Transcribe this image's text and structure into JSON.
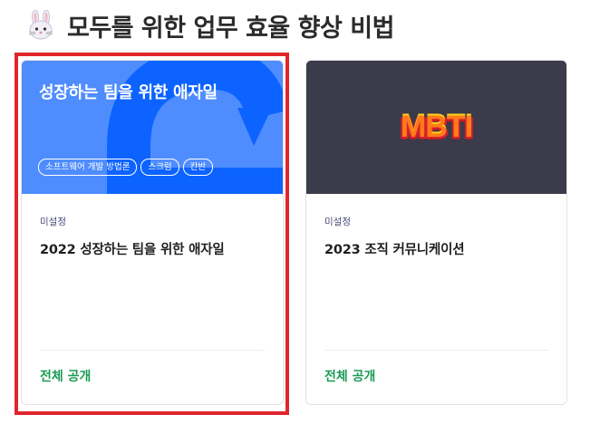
{
  "page": {
    "title": "모두를 위한 업무 효율 향상 비법",
    "title_icon": "bunny-icon"
  },
  "cards": [
    {
      "thumbnail": {
        "title": "성장하는 팀을 위한 애자일",
        "tags": [
          "소프트웨어 개발 방법론",
          "스크럼",
          "칸반"
        ],
        "background": "#4f8dff",
        "accent": "#0c63ff"
      },
      "meta": "미설정",
      "title": "2022 성장하는 팀을 위한 애자일",
      "visibility": "전체 공개",
      "highlighted": true
    },
    {
      "thumbnail": {
        "logo_text": "MBTI",
        "background": "#3b3b4b"
      },
      "meta": "미설정",
      "title": "2023 조직 커뮤니케이션",
      "visibility": "전체 공개",
      "highlighted": false
    }
  ],
  "colors": {
    "visibility_text": "#1a9b55",
    "highlight_border": "#e0252b"
  }
}
